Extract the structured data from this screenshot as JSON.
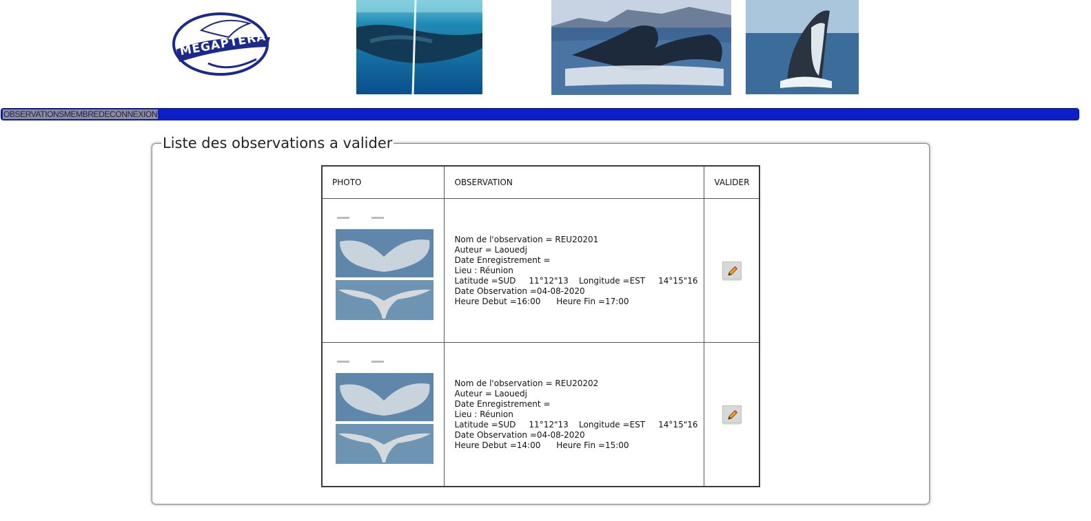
{
  "header": {
    "logo_text": "MEGAPTERA"
  },
  "nav": {
    "items": [
      "OBSERVATIONS",
      "MEMBRE",
      "DECONNEXION"
    ],
    "bar_color": "#0b20c8"
  },
  "panel": {
    "legend": "Liste des observations a valider"
  },
  "table": {
    "headers": {
      "photo": "PHOTO",
      "observation": "OBSERVATION",
      "valider": "VALIDER"
    },
    "rows": [
      {
        "nom": "Nom de l'observation = REU20201",
        "auteur": "Auteur = Laouedj",
        "date_enregistrement": "Date Enregistrement =",
        "lieu": "Lieu : Réunion",
        "coords": "Latitude =SUD     11°12\"13    Longitude =EST     14°15\"16",
        "date_observation": "Date Observation =04-08-2020",
        "heures": "Heure Debut =16:00      Heure Fin =17:00",
        "edit_icon": "pencil-icon"
      },
      {
        "nom": "Nom de l'observation = REU20202",
        "auteur": "Auteur = Laouedj",
        "date_enregistrement": "Date Enregistrement =",
        "lieu": "Lieu : Réunion",
        "coords": "Latitude =SUD     11°12\"13    Longitude =EST     14°15\"16",
        "date_observation": "Date Observation =04-08-2020",
        "heures": "Heure Debut =14:00      Heure Fin =15:00",
        "edit_icon": "pencil-icon"
      }
    ]
  }
}
